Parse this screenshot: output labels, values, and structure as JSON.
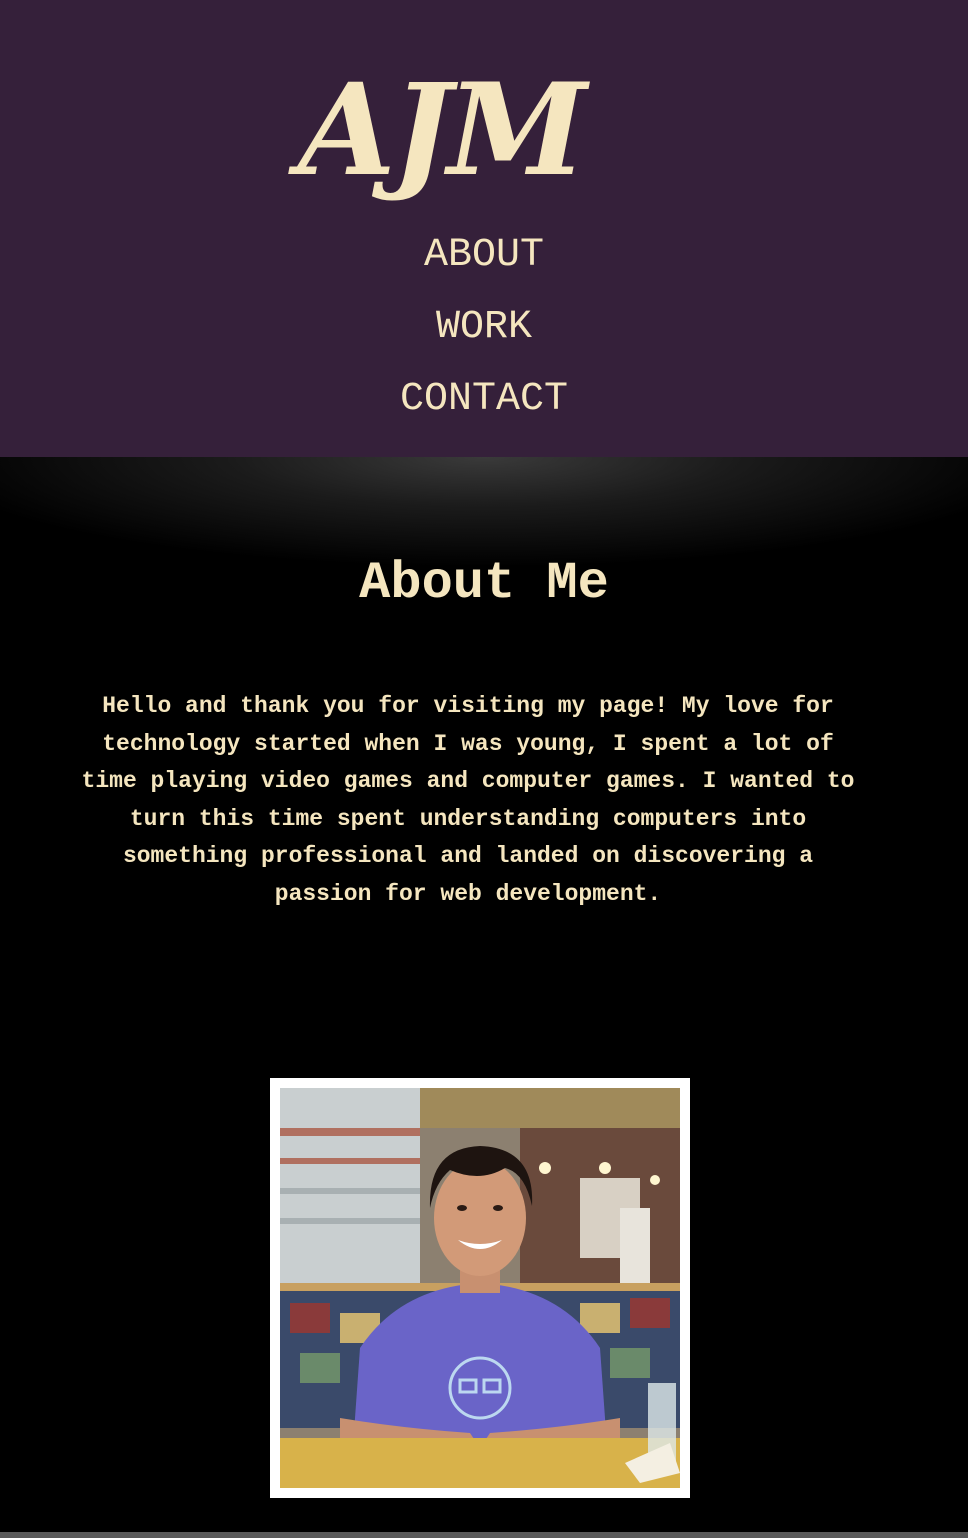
{
  "header": {
    "logo_text": "AJM",
    "nav": [
      {
        "label": "ABOUT"
      },
      {
        "label": "WORK"
      },
      {
        "label": "CONTACT"
      }
    ]
  },
  "about": {
    "title": "About Me",
    "paragraph": "Hello and thank you for visiting my page! My love for technology started when I was young, I spent a lot of time playing video games and computer games. I wanted to turn this time spent understanding computers into something professional and landed on discovering a passion for web development."
  },
  "colors": {
    "header_bg": "#35203a",
    "accent_text": "#f5e6bf",
    "page_bg": "#000000",
    "photo_frame": "#ffffff"
  }
}
